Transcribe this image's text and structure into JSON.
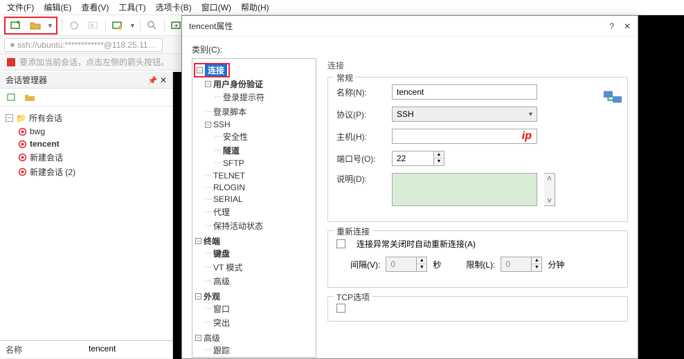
{
  "menu": {
    "file": "文件(F)",
    "edit": "编辑(E)",
    "view": "查看(V)",
    "tools": "工具(T)",
    "tabs": "选项卡(B)",
    "window": "窗口(W)",
    "help": "帮助(H)"
  },
  "address_tab": "ssh://ubuntu:************@118.25.11…",
  "hint": "要添加当前会话，点击左侧的箭头按钮。",
  "session_panel": {
    "title": "会话管理器",
    "root": "所有会话",
    "items": [
      "bwg",
      "tencent",
      "新建会话",
      "新建会话 (2)"
    ],
    "props": {
      "name_h": "名称",
      "name_v": "tencent"
    }
  },
  "dialog": {
    "title": "tencent属性",
    "category_label": "类别(C):",
    "tree": {
      "connection": "连接",
      "auth": "用户身份验证",
      "login_prompt": "登录提示符",
      "login_script": "登录脚本",
      "ssh": "SSH",
      "security": "安全性",
      "tunnel": "隧道",
      "sftp": "SFTP",
      "telnet": "TELNET",
      "rlogin": "RLOGIN",
      "serial": "SERIAL",
      "proxy": "代理",
      "keepalive": "保持活动状态",
      "terminal": "终端",
      "keyboard": "键盘",
      "vt": "VT 模式",
      "advanced": "高级",
      "appearance": "外观",
      "window": "窗口",
      "highlight": "突出",
      "adv": "高级",
      "trace": "跟踪"
    },
    "form": {
      "header": "连接",
      "group_general": "常规",
      "name_l": "名称(N):",
      "name_v": "tencent",
      "proto_l": "协议(P):",
      "proto_v": "SSH",
      "host_l": "主机(H):",
      "host_v": "",
      "host_hint": "ip",
      "port_l": "端口号(O):",
      "port_v": "22",
      "desc_l": "说明(D):",
      "group_reconnect": "重新连接",
      "reconnect_chk": "连接异常关闭时自动重新连接(A)",
      "interval_l": "间隔(V):",
      "interval_v": "0",
      "interval_u": "秒",
      "limit_l": "限制(L):",
      "limit_v": "0",
      "limit_u": "分钟",
      "group_tcp": "TCP选项"
    }
  }
}
